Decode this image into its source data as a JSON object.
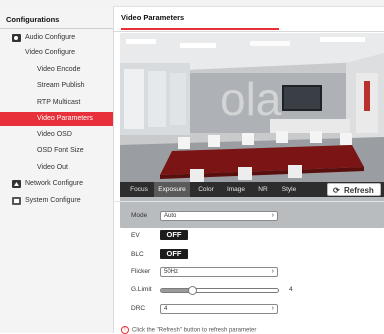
{
  "sidebar": {
    "title": "Configurations",
    "items": [
      {
        "label": "Audio Configure",
        "icon": "speaker-icon"
      },
      {
        "label": "Video Configure",
        "icon": "video-icon"
      },
      {
        "label": "Video Encode"
      },
      {
        "label": "Stream Publish"
      },
      {
        "label": "RTP Multicast"
      },
      {
        "label": "Video Parameters",
        "active": true
      },
      {
        "label": "Video OSD"
      },
      {
        "label": "OSD Font Size"
      },
      {
        "label": "Video Out"
      },
      {
        "label": "Network Configure",
        "icon": "network-icon"
      },
      {
        "label": "System Configure",
        "icon": "system-icon"
      }
    ]
  },
  "main": {
    "title": "Video Parameters",
    "accent_color": "#e8303a"
  },
  "tabs": [
    "Focus",
    "Exposure",
    "Color",
    "Image",
    "NR",
    "Style"
  ],
  "active_tab": "Exposure",
  "refresh_label": "Refresh",
  "settings": {
    "mode": {
      "label": "Mode",
      "value": "Auto"
    },
    "ev": {
      "label": "EV",
      "value": "OFF"
    },
    "blc": {
      "label": "BLC",
      "value": "OFF"
    },
    "flicker": {
      "label": "Flicker",
      "value": "50Hz"
    },
    "glimit": {
      "label": "G.Limit",
      "value": "4",
      "fraction": 0.25
    },
    "drc": {
      "label": "DRC",
      "value": "4"
    }
  },
  "note": "Click the \"Refresh\" button to refresh parameter"
}
